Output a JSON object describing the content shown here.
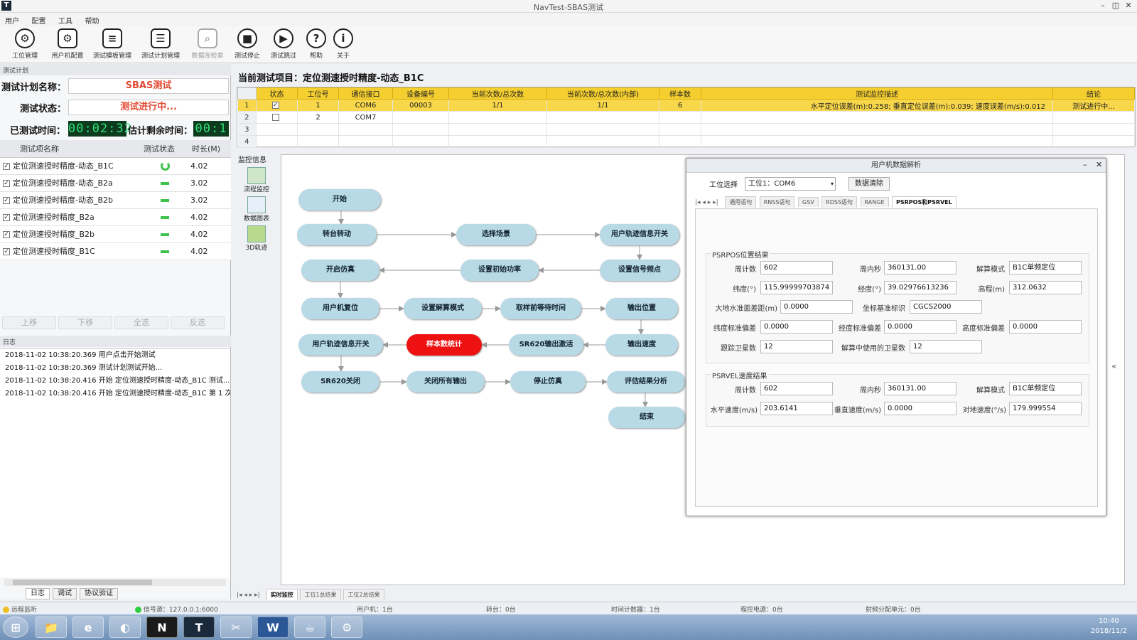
{
  "window": {
    "title": "NavTest-SBAS测试",
    "app_icon": "T",
    "controls": [
      "–",
      "◫",
      "✕"
    ]
  },
  "menu": [
    "用户",
    "配置",
    "工具",
    "帮助"
  ],
  "toolbar": [
    {
      "label": "工位管理",
      "icon": "gear-icon",
      "glyph": "⚙",
      "disabled": false
    },
    {
      "label": "用户机配置",
      "icon": "device-gear-icon",
      "glyph": "⚙",
      "disabled": false
    },
    {
      "label": "测试模板管理",
      "icon": "template-doc-icon",
      "glyph": "≡",
      "disabled": false
    },
    {
      "label": "测试计划管理",
      "icon": "plan-doc-icon",
      "glyph": "☰",
      "disabled": false
    },
    {
      "label": "数据库检索",
      "icon": "database-search-icon",
      "glyph": "⌕",
      "disabled": true
    },
    {
      "label": "测试停止",
      "icon": "stop-icon",
      "glyph": "■",
      "disabled": false
    },
    {
      "label": "测试跳过",
      "icon": "skip-icon",
      "glyph": "▶",
      "disabled": false
    },
    {
      "label": "帮助",
      "icon": "help-icon",
      "glyph": "?",
      "disabled": false
    },
    {
      "label": "关于",
      "icon": "info-icon",
      "glyph": "i",
      "disabled": false
    }
  ],
  "left": {
    "caption": "测试计划",
    "plan_name_label": "测试计划名称：",
    "plan_name": "SBAS测试",
    "status_label": "测试状态：",
    "status": "测试进行中...",
    "elapsed_label": "已测试时间：",
    "elapsed": "00:02:32",
    "remaining_label": "估计剩余时间：",
    "remaining": "00:1",
    "columns": [
      "测试项名称",
      "测试状态",
      "时长(M)"
    ],
    "items": [
      {
        "name": "定位测速授时精度-动态_B1C",
        "state": "running",
        "duration": "4.02"
      },
      {
        "name": "定位测速授时精度-动态_B2a",
        "state": "waiting",
        "duration": "3.02"
      },
      {
        "name": "定位测速授时精度-动态_B2b",
        "state": "waiting",
        "duration": "3.02"
      },
      {
        "name": "定位测速授时精度_B2a",
        "state": "waiting",
        "duration": "4.02"
      },
      {
        "name": "定位测速授时精度_B2b",
        "state": "waiting",
        "duration": "4.02"
      },
      {
        "name": "定位测速授时精度_B1C",
        "state": "waiting",
        "duration": "4.02"
      }
    ],
    "buttons": [
      "上移",
      "下移",
      "全选",
      "反选"
    ],
    "log_caption": "日志",
    "logs": [
      "2018-11-02 10:38:20.369 用户点击开始测试",
      "2018-11-02 10:38:20.369 测试计划测试开始...",
      "2018-11-02 10:38:20.416 开始 定位测速授时精度-动态_B1C 测试...",
      "2018-11-02 10:38:20.416 开始 定位测速授时精度-动态_B1C 第 1 次测"
    ],
    "bottom_tabs": [
      "日志",
      "调试",
      "协议验证"
    ]
  },
  "right": {
    "title": "当前测试项目：定位测速授时精度-动态_B1C",
    "grid_columns": [
      "状态",
      "工位号",
      "通信接口",
      "设备编号",
      "当前次数/总次数",
      "当前次数/总次数(内部)",
      "样本数",
      "测试监控描述",
      "结论"
    ],
    "grid_rows": [
      {
        "n": "1",
        "checked": true,
        "station": "1",
        "port": "COM6",
        "device": "00003",
        "count": "1/1",
        "count_inner": "1/1",
        "samples": "6",
        "desc": "水平定位误差(m):0.258; 垂直定位误差(m):0.039; 速度误差(m/s):0.012",
        "result": "测试进行中..."
      },
      {
        "n": "2",
        "checked": false,
        "station": "2",
        "port": "COM7",
        "device": "",
        "count": "",
        "count_inner": "",
        "samples": "",
        "desc": "",
        "result": ""
      },
      {
        "n": "3",
        "checked": null,
        "station": "",
        "port": "",
        "device": "",
        "count": "",
        "count_inner": "",
        "samples": "",
        "desc": "",
        "result": ""
      },
      {
        "n": "4",
        "checked": null,
        "station": "",
        "port": "",
        "device": "",
        "count": "",
        "count_inner": "",
        "samples": "",
        "desc": "",
        "result": ""
      }
    ],
    "monitor_caption": "监控信息",
    "monitor_buttons": [
      "流程监控",
      "数据图表",
      "3D轨迹"
    ],
    "flow_nodes": {
      "start": "开始",
      "turntable": "转台转动",
      "scene": "选择场景",
      "track_on": "用户轨迹信息开关",
      "sim_on": "开启仿真",
      "init_power": "设置初始功率",
      "freq": "设置信号频点",
      "reset": "用户机复位",
      "solve_mode": "设置解算模式",
      "wait": "取样前等待时间",
      "out_pos": "输出位置",
      "track_sw": "用户轨迹信息开关",
      "stats": "样本数统计",
      "sr620": "SR620输出激活",
      "out_vel": "输出速度",
      "sr620_off": "SR620关闭",
      "close_out": "关闭所有输出",
      "stop_sim": "停止仿真",
      "eval": "评估结果分析",
      "end": "结束"
    },
    "bottom_tabs": [
      "实时监控",
      "工位1总结果",
      "工位2总结果"
    ]
  },
  "dialog": {
    "title": "用户机数据解析",
    "station_label": "工位选择",
    "station_value": "工位1：COM6",
    "clear_button": "数据清除",
    "tabs": [
      "通用语句",
      "RNSS语句",
      "GSV",
      "RDSS语句",
      "RANGE",
      "PSRPOS和PSRVEL"
    ],
    "active_tab": "PSRPOS和PSRVEL",
    "pos_caption": "PSRPOS位置结果",
    "pos": {
      "week_label": "周计数",
      "week": "602",
      "sow_label": "周内秒",
      "sow": "360131.00",
      "mode_label": "解算模式",
      "mode": "B1C单频定位",
      "lat_label": "纬度(°)",
      "lat": "115.99999703874",
      "lon_label": "经度(°)",
      "lon": "39.02976613236",
      "alt_label": "高程(m)",
      "alt": "312.0632",
      "geoid_label": "大地水准面差距(m)",
      "geoid": "0.0000",
      "datum_label": "坐标基准标识",
      "datum": "CGCS2000",
      "lat_sd_label": "纬度标准偏差",
      "lat_sd": "0.0000",
      "lon_sd_label": "经度标准偏差",
      "lon_sd": "0.0000",
      "alt_sd_label": "高度标准偏差",
      "alt_sd": "0.0000",
      "track_sats_label": "跟踪卫星数",
      "track_sats": "12",
      "used_sats_label": "解算中使用的卫星数",
      "used_sats": "12"
    },
    "vel_caption": "PSRVEL速度结果",
    "vel": {
      "week_label": "周计数",
      "week": "602",
      "sow_label": "周内秒",
      "sow": "360131.00",
      "mode_label": "解算模式",
      "mode": "B1C单频定位",
      "hspeed_label": "水平速度(m/s)",
      "hspeed": "203.6141",
      "vspeed_label": "垂直速度(m/s)",
      "vspeed": "0.0000",
      "heading_label": "对地速度(°/s)",
      "heading": "179.999554"
    }
  },
  "status": {
    "remote": "远程监听",
    "signal": "信号源：127.0.0.1:6000",
    "user": "用户机：1台",
    "turntable": "转台：0台",
    "counter": "时间计数器：1台",
    "power": "程控电源：0台",
    "splitter": "射频分配单元：0台"
  },
  "taskbar": {
    "apps": [
      "⊞",
      "📁",
      "e",
      "◐",
      "N",
      "T",
      "✂",
      "W",
      "☕",
      "⚙"
    ],
    "time": "10:40",
    "date": "2018/11/2"
  },
  "colors": {
    "grid_header": "#f5cf2f",
    "selected_row": "#f8d74a",
    "node": "#b8d9e6",
    "active_node": "#ee1111",
    "status_text": "#e34a33",
    "lcd_bg": "#0d3b1e",
    "lcd_fg": "#2fe27a"
  }
}
